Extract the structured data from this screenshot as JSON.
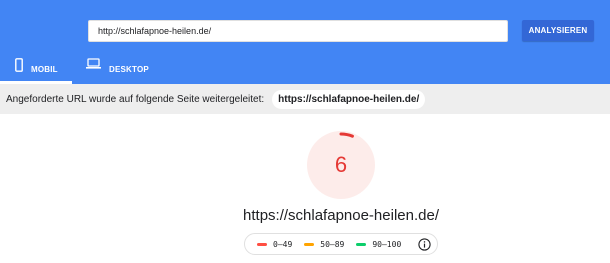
{
  "search": {
    "url_value": "http://schlafapnoe-heilen.de/",
    "analyze_label": "ANALYSIEREN"
  },
  "tabs": [
    {
      "label": "MOBIL",
      "icon": "smartphone-icon",
      "active": true
    },
    {
      "label": "DESKTOP",
      "icon": "laptop-icon",
      "active": false
    }
  ],
  "redirect": {
    "message": "Angeforderte URL wurde auf folgende Seite weitergeleitet:",
    "target": "https://schlafapnoe-heilen.de/"
  },
  "score": {
    "value": "6",
    "fraction": 0.06,
    "color": "#e53935",
    "track_color": "#fdecea"
  },
  "site_url": "https://schlafapnoe-heilen.de/",
  "legend": [
    {
      "range": "0–49",
      "color": "#ff4e42"
    },
    {
      "range": "50–89",
      "color": "#ffa400"
    },
    {
      "range": "90–100",
      "color": "#0cce6b"
    }
  ],
  "colors": {
    "header": "#4285f4",
    "button": "#3367d6"
  }
}
